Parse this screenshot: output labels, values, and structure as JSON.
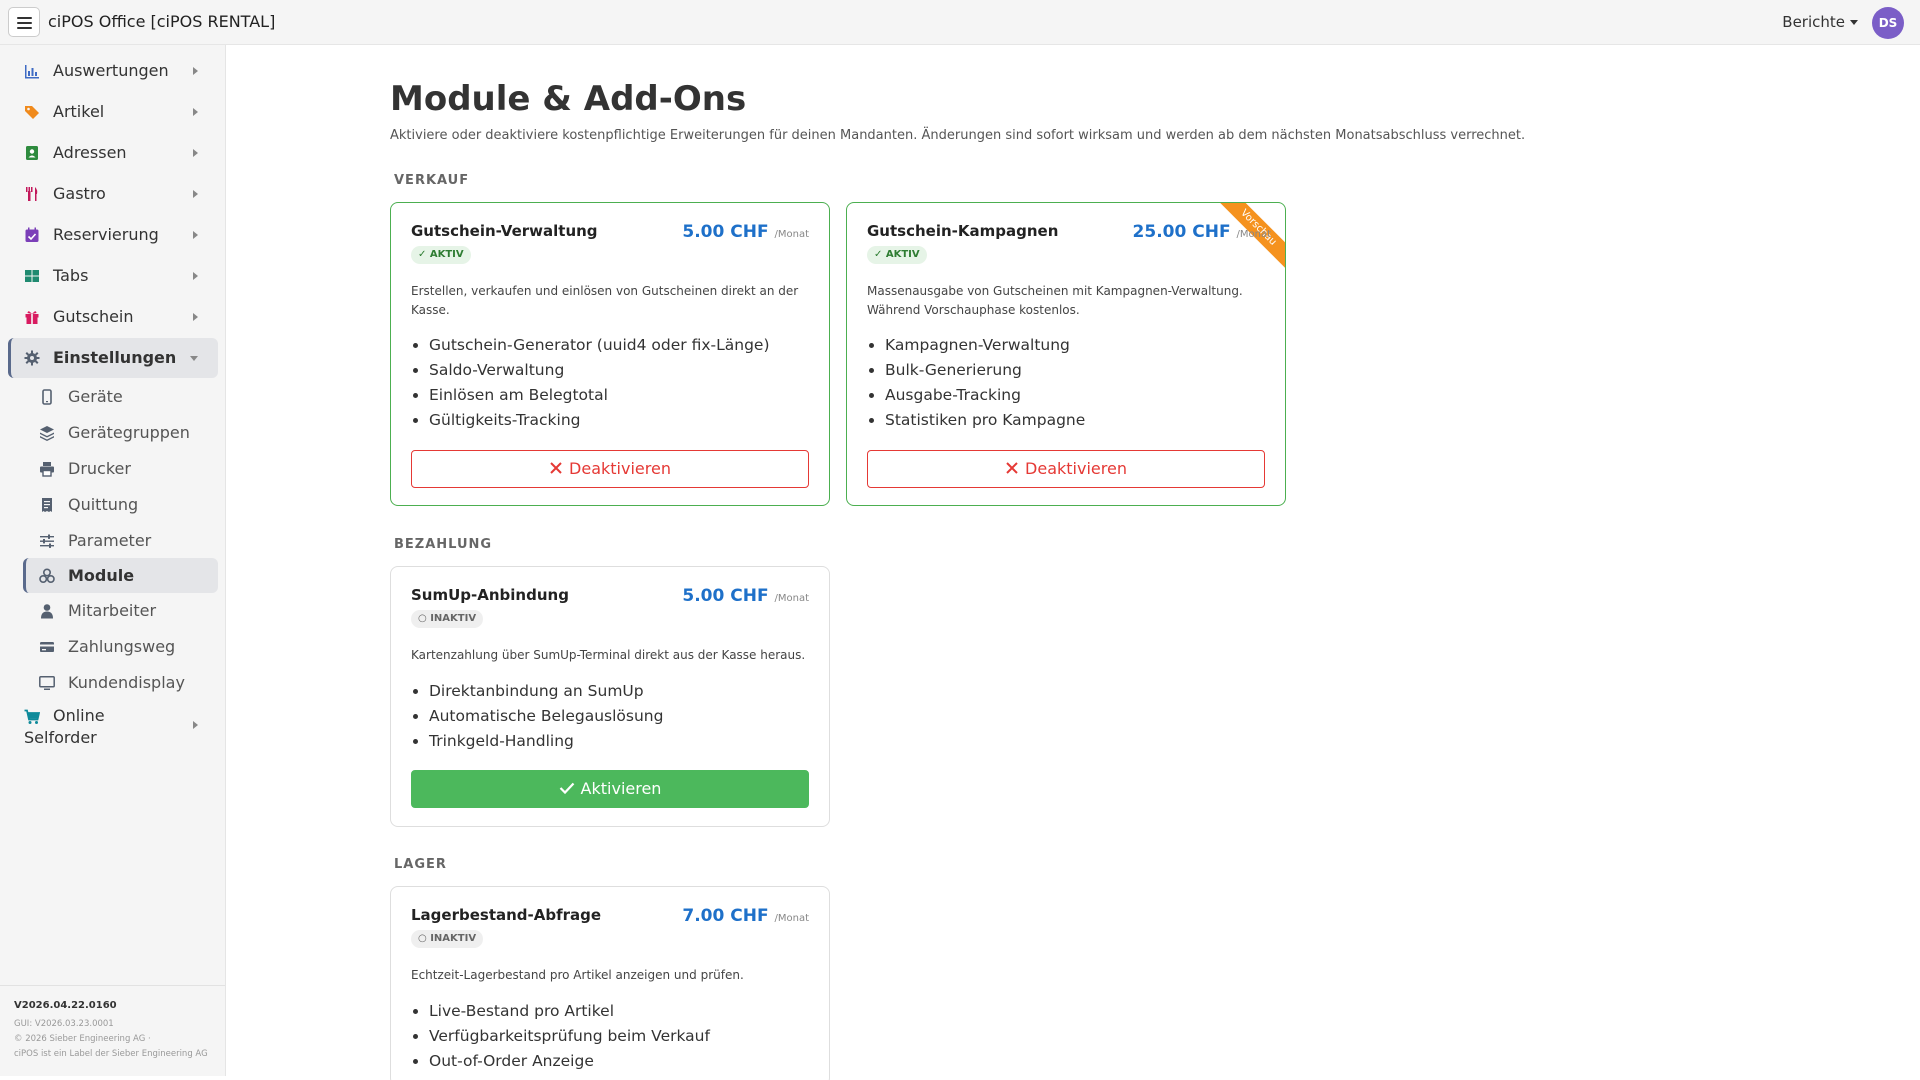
{
  "app": {
    "title": "ciPOS Office [ciPOS RENTAL]",
    "reports_label": "Berichte",
    "avatar_initials": "DS",
    "avatar_color": "#7b5ec7"
  },
  "sidebar": {
    "items": [
      {
        "label": "Auswertungen",
        "icon": "chart-icon"
      },
      {
        "label": "Artikel",
        "icon": "tags-icon"
      },
      {
        "label": "Adressen",
        "icon": "address-book-icon"
      },
      {
        "label": "Gastro",
        "icon": "utensils-icon"
      },
      {
        "label": "Reservierung",
        "icon": "calendar-check-icon"
      },
      {
        "label": "Tabs",
        "icon": "table-grid-icon"
      },
      {
        "label": "Gutschein",
        "icon": "gift-icon"
      },
      {
        "label": "Einstellungen",
        "icon": "gear-icon"
      }
    ],
    "sub_items": [
      {
        "label": "Geräte",
        "icon": "mobile-icon"
      },
      {
        "label": "Gerätegruppen",
        "icon": "layers-icon"
      },
      {
        "label": "Drucker",
        "icon": "printer-icon"
      },
      {
        "label": "Quittung",
        "icon": "receipt-icon"
      },
      {
        "label": "Parameter",
        "icon": "sliders-icon"
      },
      {
        "label": "Module",
        "icon": "cubes-icon"
      },
      {
        "label": "Mitarbeiter",
        "icon": "user-icon"
      },
      {
        "label": "Zahlungsweg",
        "icon": "credit-card-icon"
      },
      {
        "label": "Kundendisplay",
        "icon": "monitor-icon"
      }
    ],
    "online": {
      "label_line1": "Online",
      "label_line2": "Selforder",
      "icon": "cart-icon"
    },
    "footer": {
      "version": "V2026.04.22.0160",
      "gui": "GUI: V2026.03.23.0001",
      "copyright": "© 2026 Sieber Engineering AG ·",
      "label": "ciPOS ist ein Label der Sieber Engineering AG"
    }
  },
  "page": {
    "title": "Module & Add-Ons",
    "subtitle": "Aktiviere oder deaktiviere kostenpflichtige Erweiterungen für deinen Mandanten. Änderungen sind sofort wirksam und werden ab dem nächsten Monatsabschluss verrechnet."
  },
  "sections": {
    "verkauf": "VERKAUF",
    "bezahlung": "BEZAHLUNG",
    "lager": "LAGER"
  },
  "modules": {
    "voucher": {
      "title": "Gutschein-Verwaltung",
      "price": "5.00 CHF",
      "per": "/Monat",
      "status": "✓ AKTIV",
      "desc": "Erstellen, verkaufen und einlösen von Gutscheinen direkt an der Kasse.",
      "features": [
        "Gutschein-Generator (uuid4 oder fix-Länge)",
        "Saldo-Verwaltung",
        "Einlösen am Belegtotal",
        "Gültigkeits-Tracking"
      ],
      "button": "Deaktivieren"
    },
    "campaigns": {
      "title": "Gutschein-Kampagnen",
      "price": "25.00 CHF",
      "per": "/Monat",
      "status": "✓ AKTIV",
      "ribbon": "Vorschau",
      "desc": "Massenausgabe von Gutscheinen mit Kampagnen-Verwaltung. Während Vorschauphase kostenlos.",
      "features": [
        "Kampagnen-Verwaltung",
        "Bulk-Generierung",
        "Ausgabe-Tracking",
        "Statistiken pro Kampagne"
      ],
      "button": "Deaktivieren"
    },
    "sumup": {
      "title": "SumUp-Anbindung",
      "price": "5.00 CHF",
      "per": "/Monat",
      "status": "○ INAKTIV",
      "desc": "Kartenzahlung über SumUp-Terminal direkt aus der Kasse heraus.",
      "features": [
        "Direktanbindung an SumUp",
        "Automatische Belegauslösung",
        "Trinkgeld-Handling"
      ],
      "button": "Aktivieren"
    },
    "stock": {
      "title": "Lagerbestand-Abfrage",
      "price": "7.00 CHF",
      "per": "/Monat",
      "status": "○ INAKTIV",
      "desc": "Echtzeit-Lagerbestand pro Artikel anzeigen und prüfen.",
      "features": [
        "Live-Bestand pro Artikel",
        "Verfügbarkeitsprüfung beim Verkauf",
        "Out-of-Order Anzeige"
      ]
    }
  },
  "colors": {
    "active_border": "#4caf50",
    "price": "#1e70c9",
    "deactivate": "#e53935",
    "activate": "#4cb85c",
    "ribbon": "#f5921e"
  }
}
